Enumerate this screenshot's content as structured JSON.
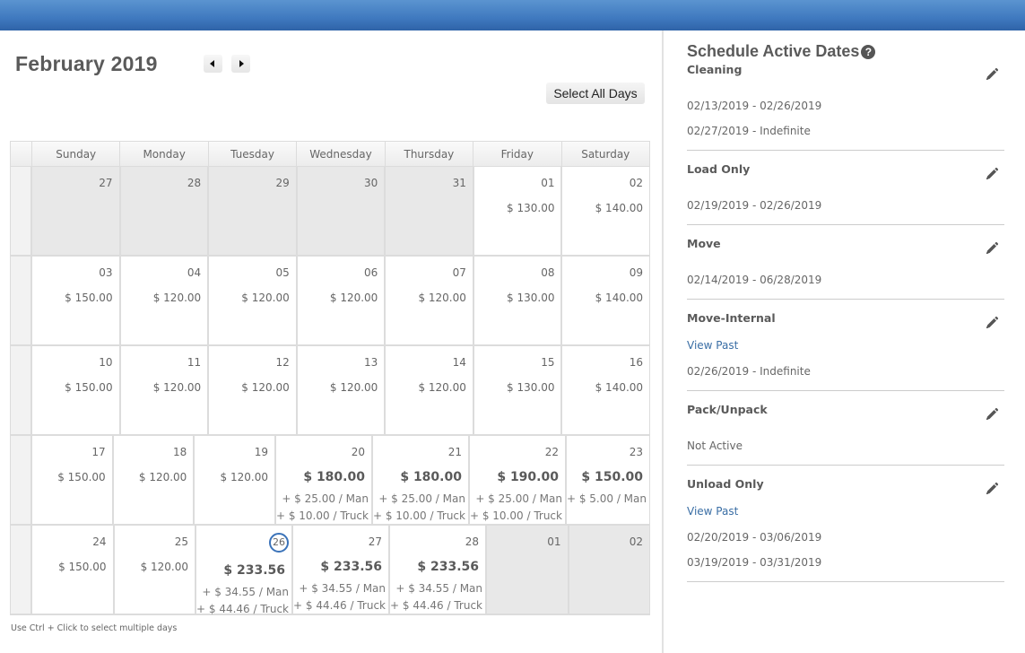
{
  "header": {
    "month_title": "February 2019"
  },
  "nav": {
    "prev_label": "previous month",
    "next_label": "next month"
  },
  "toolbar": {
    "select_all_label": "Select All Days"
  },
  "calendar": {
    "weekdays": [
      "Sunday",
      "Monday",
      "Tuesday",
      "Wednesday",
      "Thursday",
      "Friday",
      "Saturday"
    ],
    "weeks": [
      [
        {
          "day": "27",
          "other": true
        },
        {
          "day": "28",
          "other": true
        },
        {
          "day": "29",
          "other": true
        },
        {
          "day": "30",
          "other": true
        },
        {
          "day": "31",
          "other": true
        },
        {
          "day": "01",
          "price": "$ 130.00"
        },
        {
          "day": "02",
          "price": "$ 140.00"
        }
      ],
      [
        {
          "day": "03",
          "price": "$ 150.00"
        },
        {
          "day": "04",
          "price": "$ 120.00"
        },
        {
          "day": "05",
          "price": "$ 120.00"
        },
        {
          "day": "06",
          "price": "$ 120.00"
        },
        {
          "day": "07",
          "price": "$ 120.00"
        },
        {
          "day": "08",
          "price": "$ 130.00"
        },
        {
          "day": "09",
          "price": "$ 140.00"
        }
      ],
      [
        {
          "day": "10",
          "price": "$ 150.00"
        },
        {
          "day": "11",
          "price": "$ 120.00"
        },
        {
          "day": "12",
          "price": "$ 120.00"
        },
        {
          "day": "13",
          "price": "$ 120.00"
        },
        {
          "day": "14",
          "price": "$ 120.00"
        },
        {
          "day": "15",
          "price": "$ 130.00"
        },
        {
          "day": "16",
          "price": "$ 140.00"
        }
      ],
      [
        {
          "day": "17",
          "price": "$ 150.00"
        },
        {
          "day": "18",
          "price": "$ 120.00"
        },
        {
          "day": "19",
          "price": "$ 120.00"
        },
        {
          "day": "20",
          "price": "$ 180.00",
          "bold": true,
          "extras": [
            "+ $ 25.00 / Man",
            "+ $ 10.00 / Truck"
          ]
        },
        {
          "day": "21",
          "price": "$ 180.00",
          "bold": true,
          "extras": [
            "+ $ 25.00 / Man",
            "+ $ 10.00 / Truck"
          ]
        },
        {
          "day": "22",
          "price": "$ 190.00",
          "bold": true,
          "extras": [
            "+ $ 25.00 / Man",
            "+ $ 10.00 / Truck"
          ]
        },
        {
          "day": "23",
          "price": "$ 150.00",
          "bold": true,
          "extras": [
            "+ $ 5.00 / Man"
          ]
        }
      ],
      [
        {
          "day": "24",
          "price": "$ 150.00"
        },
        {
          "day": "25",
          "price": "$ 120.00"
        },
        {
          "day": "26",
          "price": "$ 233.56",
          "bold": true,
          "today": true,
          "extras": [
            "+ $ 34.55 / Man",
            "+ $ 44.46 / Truck"
          ]
        },
        {
          "day": "27",
          "price": "$ 233.56",
          "bold": true,
          "extras": [
            "+ $ 34.55 / Man",
            "+ $ 44.46 / Truck"
          ]
        },
        {
          "day": "28",
          "price": "$ 233.56",
          "bold": true,
          "extras": [
            "+ $ 34.55 / Man",
            "+ $ 44.46 / Truck"
          ]
        },
        {
          "day": "01",
          "other": true
        },
        {
          "day": "02",
          "other": true
        }
      ]
    ],
    "hint": "Use Ctrl + Click to select multiple days"
  },
  "panel": {
    "title": "Schedule Active Dates",
    "help_icon": "question-circle-icon",
    "edit_icon": "pencil-icon",
    "sections": [
      {
        "name": "Cleaning",
        "view_past": null,
        "ranges": [
          "02/13/2019 - 02/26/2019",
          "02/27/2019 - Indefinite"
        ]
      },
      {
        "name": "Load Only",
        "view_past": null,
        "ranges": [
          "02/19/2019 - 02/26/2019"
        ]
      },
      {
        "name": "Move",
        "view_past": null,
        "ranges": [
          "02/14/2019 - 06/28/2019"
        ]
      },
      {
        "name": "Move-Internal",
        "view_past": "View Past",
        "ranges": [
          "02/26/2019 - Indefinite"
        ]
      },
      {
        "name": "Pack/Unpack",
        "view_past": null,
        "ranges": [
          "Not Active"
        ]
      },
      {
        "name": "Unload Only",
        "view_past": "View Past",
        "ranges": [
          "02/20/2019 - 03/06/2019",
          "03/19/2019 - 03/31/2019"
        ]
      }
    ]
  },
  "colors": {
    "topbar": "#3f79bf",
    "link": "#3a6ea5",
    "today_ring": "#3b73b9",
    "other_month_bg": "#e8e8e8"
  }
}
